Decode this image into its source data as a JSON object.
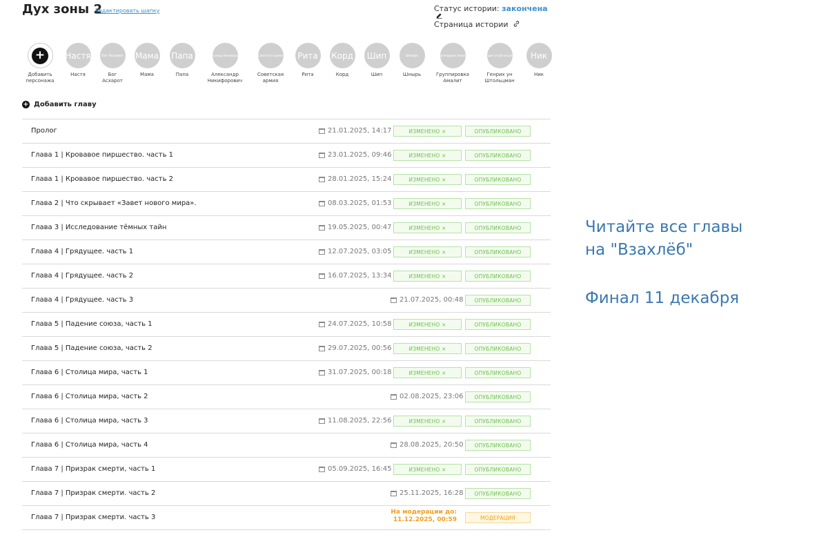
{
  "header": {
    "title": "Дух зоны 2",
    "edit_link": "Редактировать шапку",
    "status_label": "Статус истории:",
    "status_value": "закончена",
    "history_page": "Страница истории"
  },
  "characters": {
    "add": {
      "label_line1": "Добавить",
      "label_line2": "персонажа"
    },
    "items": [
      {
        "avatar_text": "Настя",
        "label_line1": "Настя",
        "label_line2": ""
      },
      {
        "avatar_text": "Бог Асхарот",
        "label_line1": "Бог",
        "label_line2": "Асхарот"
      },
      {
        "avatar_text": "Мама",
        "label_line1": "Мама",
        "label_line2": ""
      },
      {
        "avatar_text": "Папа",
        "label_line1": "Папа",
        "label_line2": ""
      },
      {
        "avatar_text": "Александр Никифорович",
        "label_line1": "Александр",
        "label_line2": "Никифорович"
      },
      {
        "avatar_text": "Советская армия",
        "label_line1": "Советская",
        "label_line2": "армия"
      },
      {
        "avatar_text": "Рита",
        "label_line1": "Рита",
        "label_line2": ""
      },
      {
        "avatar_text": "Корд",
        "label_line1": "Корд",
        "label_line2": ""
      },
      {
        "avatar_text": "Шип",
        "label_line1": "Шип",
        "label_line2": ""
      },
      {
        "avatar_text": "Шнырь",
        "label_line1": "Шнырь",
        "label_line2": ""
      },
      {
        "avatar_text": "Группировка Амалит",
        "label_line1": "Группировка",
        "label_line2": "Амалит"
      },
      {
        "avatar_text": "Генрих ун Штольцман",
        "label_line1": "Генрих ун",
        "label_line2": "Штольцман"
      },
      {
        "avatar_text": "Ник",
        "label_line1": "Ник",
        "label_line2": ""
      }
    ]
  },
  "add_chapter": "Добавить главу",
  "labels": {
    "changed": "изменено ×",
    "published": "опубликовано",
    "moderation": "модерация"
  },
  "chapters": [
    {
      "title": "Пролог",
      "date": "21.01.2025, 14:17",
      "changed": true
    },
    {
      "title": "Глава 1 | Кровавое пиршество. часть 1",
      "date": "23.01.2025, 09:46",
      "changed": true
    },
    {
      "title": "Глава 1 | Кровавое пиршество. часть 2",
      "date": "28.01.2025, 15:24",
      "changed": true
    },
    {
      "title": "Глава 2 | Что скрывает «Завет нового мира».",
      "date": "08.03.2025, 01:53",
      "changed": true
    },
    {
      "title": "Глава 3 | Исследование тёмных тайн",
      "date": "19.05.2025, 00:47",
      "changed": true
    },
    {
      "title": "Глава 4 | Грядущее. часть 1",
      "date": "12.07.2025, 03:05",
      "changed": true
    },
    {
      "title": "Глава 4 | Грядущее. часть 2",
      "date": "16.07.2025, 13:34",
      "changed": true
    },
    {
      "title": "Глава 4 | Грядущее. часть 3",
      "date": "21.07.2025, 00:48",
      "changed": false
    },
    {
      "title": "Глава 5 | Падение союза, часть 1",
      "date": "24.07.2025, 10:58",
      "changed": true
    },
    {
      "title": "Глава 5 | Падение союза, часть 2",
      "date": "29.07.2025, 00:56",
      "changed": true
    },
    {
      "title": "Глава 6 | Столица мира, часть 1",
      "date": "31.07.2025, 00:18",
      "changed": true
    },
    {
      "title": "Глава 6 | Столица мира, часть 2",
      "date": "02.08.2025, 23:06",
      "changed": false
    },
    {
      "title": "Глава 6 | Столица мира, часть 3",
      "date": "11.08.2025, 22:56",
      "changed": true
    },
    {
      "title": "Глава 6 | Столица мира, часть 4",
      "date": "28.08.2025, 20:50",
      "changed": false
    },
    {
      "title": "Глава 7 | Призрак смерти, часть 1",
      "date": "05.09.2025, 16:45",
      "changed": true
    },
    {
      "title": "Глава 7 | Призрак смерти. часть 2",
      "date": "25.11.2025, 16:28",
      "changed": false
    },
    {
      "title": "Глава 7 | Призрак смерти. часть 3",
      "moderation_line1": "На модерации до:",
      "moderation_line2": "11.12.2025, 00:59",
      "moderation": true
    }
  ],
  "promo": {
    "line1": "Читайте все главы",
    "line2": "на \"Взахлёб\"",
    "line3": "Финал 11 декабря"
  },
  "colors": {
    "accent": "#3a8fd1",
    "published_green": "#6cc04a",
    "moderation_orange": "#f0a020",
    "promo_blue": "#3b78b0"
  }
}
